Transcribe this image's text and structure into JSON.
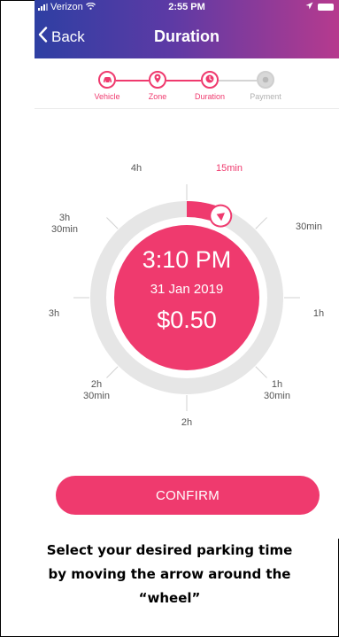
{
  "status_bar": {
    "carrier": "Verizon",
    "time": "2:55 PM"
  },
  "nav": {
    "back_label": "Back",
    "title": "Duration"
  },
  "steps": [
    {
      "label": "Vehicle",
      "state": "done",
      "icon": "car-icon"
    },
    {
      "label": "Zone",
      "state": "done",
      "icon": "map-pin-icon"
    },
    {
      "label": "Duration",
      "state": "current",
      "icon": "clock-icon"
    },
    {
      "label": "Payment",
      "state": "pending",
      "icon": "coin-icon"
    }
  ],
  "dial": {
    "labels": {
      "h4": "4h",
      "min15": "15min",
      "h3_30a": "3h",
      "h3_30b": "30min",
      "min30": "30min",
      "h3": "3h",
      "h1": "1h",
      "h2_30a": "2h",
      "h2_30b": "30min",
      "h1_30a": "1h",
      "h1_30b": "30min",
      "h2": "2h"
    },
    "selected_duration_minutes": 15,
    "max_duration_minutes": 240,
    "end_time": "3:10 PM",
    "end_date": "31 Jan 2019",
    "price": "$0.50"
  },
  "confirm_label": "CONFIRM",
  "caption": {
    "line1": "Select your desired parking time",
    "line2": "by moving the arrow around the",
    "line3": "“wheel”"
  },
  "colors": {
    "accent": "#ef3a6e",
    "header_start": "#2e3fa3",
    "header_end": "#b63a8e",
    "ring": "#e6e6e6"
  }
}
